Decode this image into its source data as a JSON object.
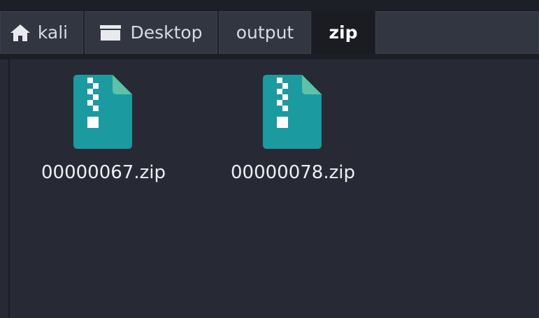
{
  "pathbar": {
    "items": [
      {
        "label": "kali",
        "icon": "home-icon"
      },
      {
        "label": "Desktop",
        "icon": "desktop-icon"
      },
      {
        "label": "output"
      },
      {
        "label": "zip",
        "active": true
      }
    ]
  },
  "files": [
    {
      "name": "00000067.zip",
      "icon": "zip-archive-icon"
    },
    {
      "name": "00000078.zip",
      "icon": "zip-archive-icon"
    }
  ],
  "colors": {
    "background": "#272a34",
    "pathbar_button": "#323641",
    "pathbar_active": "#1a1c22",
    "zip_icon_body": "#1b9aa0",
    "zip_icon_fold": "#5cc2a8"
  }
}
